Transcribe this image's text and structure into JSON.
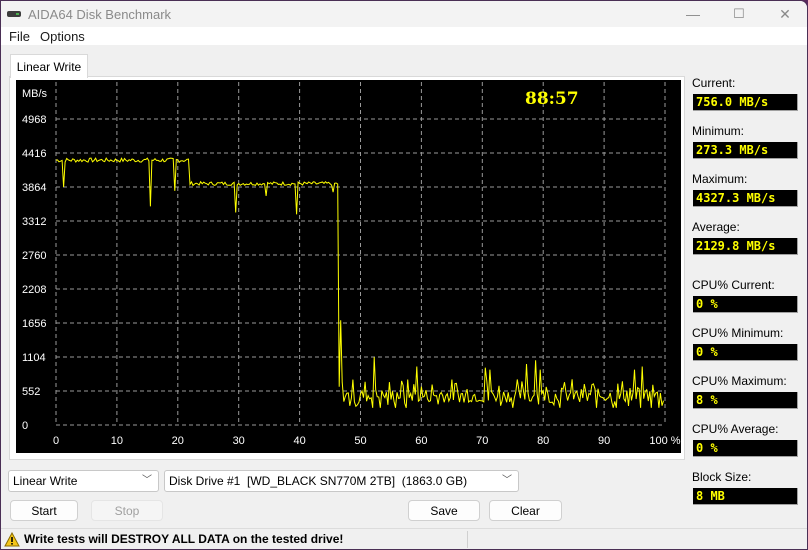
{
  "window": {
    "title": "AIDA64 Disk Benchmark",
    "controls": {
      "minimize": "—",
      "maximize": "☐",
      "close": "✕"
    }
  },
  "menu": [
    {
      "label": "File"
    },
    {
      "label": "Options"
    }
  ],
  "tabs": [
    {
      "label": "Linear Write",
      "active": true
    }
  ],
  "chart_overlay": {
    "elapsed_time": "88:57"
  },
  "side_panel": {
    "current": {
      "label": "Current:",
      "value": "756.0 MB/s"
    },
    "minimum": {
      "label": "Minimum:",
      "value": "273.3 MB/s"
    },
    "maximum": {
      "label": "Maximum:",
      "value": "4327.3 MB/s"
    },
    "average": {
      "label": "Average:",
      "value": "2129.8 MB/s"
    },
    "cpu_current": {
      "label": "CPU% Current:",
      "value": "0 %"
    },
    "cpu_minimum": {
      "label": "CPU% Minimum:",
      "value": "0 %"
    },
    "cpu_maximum": {
      "label": "CPU% Maximum:",
      "value": "8 %"
    },
    "cpu_average": {
      "label": "CPU% Average:",
      "value": "0 %"
    },
    "block_size": {
      "label": "Block Size:",
      "value": "8 MB"
    }
  },
  "controls": {
    "test_select": {
      "value": "Linear Write"
    },
    "drive_select": {
      "value": "Disk Drive #1  [WD_BLACK SN770M 2TB]  (1863.0 GB)"
    },
    "start_label": "Start",
    "stop_label": "Stop",
    "save_label": "Save",
    "clear_label": "Clear"
  },
  "status": {
    "message": "Write tests will DESTROY ALL DATA on the tested drive!"
  },
  "colors": {
    "trace": "#ffff00",
    "grid": "#9a9a9a",
    "chart_bg": "#000000",
    "label": "#ffffff"
  },
  "chart_data": {
    "type": "line",
    "title": "",
    "ylabel": "MB/s",
    "xlabel": "",
    "ylim": [
      0,
      4968
    ],
    "xlim": [
      0,
      100
    ],
    "y_ticks": [
      0,
      552,
      1104,
      1656,
      2208,
      2760,
      3312,
      3864,
      4416,
      4968
    ],
    "y_tick_labels": [
      "0",
      "552",
      "1104",
      "1656",
      "2208",
      "2760",
      "3312",
      "3864",
      "4416",
      "4968"
    ],
    "x_ticks": [
      0,
      10,
      20,
      30,
      40,
      50,
      60,
      70,
      80,
      90,
      100
    ],
    "x_tick_labels": [
      "0",
      "10",
      "20",
      "30",
      "40",
      "50",
      "60",
      "70",
      "80",
      "90",
      "100 %"
    ],
    "grid": true,
    "series": [
      {
        "name": "Linear Write",
        "segments": [
          {
            "x_start": 0,
            "x_end": 22,
            "baseline": 4300,
            "noise": 70
          },
          {
            "x_start": 22,
            "x_end": 46.5,
            "baseline": 3920,
            "noise": 60
          },
          {
            "x_start": 46.5,
            "x_end": 100,
            "baseline": 480,
            "noise": 280
          }
        ],
        "dips": [
          {
            "x": 1.2,
            "y": 3864
          },
          {
            "x": 15.5,
            "y": 3550
          },
          {
            "x": 19.5,
            "y": 3800
          },
          {
            "x": 29.5,
            "y": 3450
          },
          {
            "x": 34.5,
            "y": 3720
          },
          {
            "x": 39.5,
            "y": 3420
          },
          {
            "x": 45.5,
            "y": 3780
          }
        ],
        "spikes": [
          {
            "x": 46.8,
            "y": 1700
          },
          {
            "x": 52.3,
            "y": 1100
          },
          {
            "x": 59.3,
            "y": 950
          },
          {
            "x": 70.5,
            "y": 930
          },
          {
            "x": 71.3,
            "y": 900
          },
          {
            "x": 77.3,
            "y": 990
          },
          {
            "x": 78.8,
            "y": 1050
          },
          {
            "x": 79.5,
            "y": 900
          },
          {
            "x": 95,
            "y": 900
          },
          {
            "x": 96.3,
            "y": 950
          }
        ]
      }
    ]
  }
}
